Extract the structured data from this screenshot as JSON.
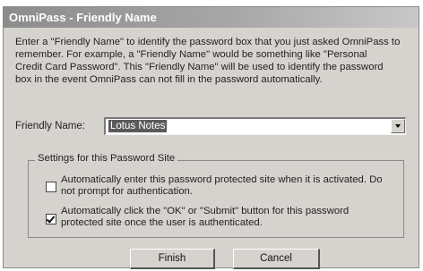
{
  "dialog": {
    "title": "OmniPass - Friendly Name",
    "intro_lines": [
      "Enter a \"Friendly Name\" to identify the password box that you just asked OmniPass to",
      "remember.   For example, a \"Friendly Name\" would be something like \"Personal",
      "Credit Card Password\".  This \"Friendly Name\" will be used to identify the password",
      "box in the event OmniPass can not fill in the password automatically."
    ],
    "friendly_name_label": "Friendly Name:",
    "friendly_name_value": "Lotus Notes",
    "settings_group_title": "Settings for this Password Site",
    "options": [
      {
        "checked": false,
        "lines": [
          "Automatically enter this password protected site when it is activated.  Do",
          "not prompt for authentication."
        ]
      },
      {
        "checked": true,
        "lines": [
          "Automatically click the \"OK\" or \"Submit\" button for this password",
          "protected site once the user is authenticated."
        ]
      }
    ],
    "finish_label": "Finish",
    "cancel_label": "Cancel"
  }
}
